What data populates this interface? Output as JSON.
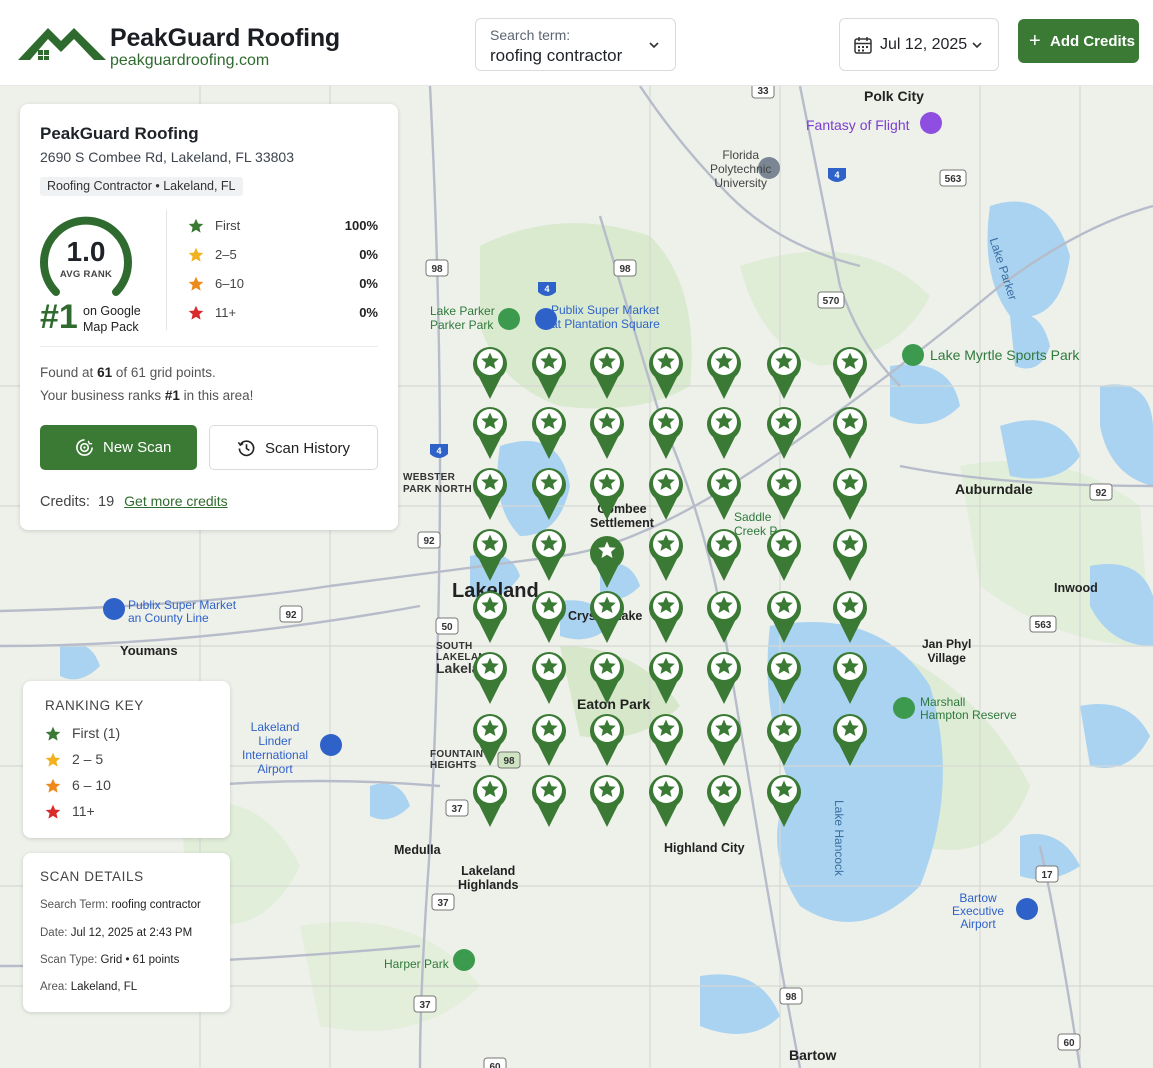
{
  "brand": {
    "name": "PeakGuard Roofing",
    "domain": "peakguardroofing.com"
  },
  "search": {
    "label": "Search term:",
    "value": "roofing contractor"
  },
  "date_picker": {
    "value": "Jul 12, 2025"
  },
  "add_credits": {
    "label": "Add Credits"
  },
  "business": {
    "name": "PeakGuard Roofing",
    "address": "2690 S Combee Rd, Lakeland, FL 33803",
    "category": "Roofing Contractor • Lakeland, FL"
  },
  "summary": {
    "avg_rank": "1.0",
    "avg_rank_caption": "AVG RANK",
    "rank_big": "#1",
    "rank_text_1": "on Google",
    "rank_text_2": "Map Pack",
    "found_prefix": "Found at",
    "found_count": "61",
    "found_of": "of",
    "found_total": "61",
    "found_suffix": "grid points.",
    "ranks_prefix": "Your business ranks",
    "ranks_value": "#1",
    "ranks_suffix": "in this area!"
  },
  "distribution": [
    {
      "label": "First",
      "pct": "100%",
      "color": "#3a7a34"
    },
    {
      "label": "2–5",
      "pct": "0%",
      "color": "#f2b21f"
    },
    {
      "label": "6–10",
      "pct": "0%",
      "color": "#ee8a1a"
    },
    {
      "label": "11+",
      "pct": "0%",
      "color": "#d92b2b"
    }
  ],
  "buttons": {
    "new_scan": "New Scan",
    "scan_history": "Scan History"
  },
  "credits": {
    "label": "Credits:",
    "count": "19",
    "link": "Get more credits"
  },
  "ranking_key": {
    "title": "RANKING KEY",
    "items": [
      {
        "label": "First (1)",
        "color": "#3a7a34"
      },
      {
        "label": "2 – 5",
        "color": "#f2b21f"
      },
      {
        "label": "6 – 10",
        "color": "#ee8a1a"
      },
      {
        "label": "11+",
        "color": "#d92b2b"
      }
    ]
  },
  "scan_details": {
    "title": "SCAN DETAILS",
    "search_term_label": "Search Term:",
    "search_term": "roofing contractor",
    "date_label": "Date:",
    "date": "Jul 12, 2025 at 2:43 PM",
    "scan_type_label": "Scan Type:",
    "scan_type": "Grid • 61 points",
    "area_label": "Area:",
    "area": "Lakeland, FL"
  },
  "map_labels": {
    "polk_city": "Polk City",
    "fantasy": "Fantasy of Flight",
    "florida_poly_1": "Florida",
    "florida_poly_2": "Polytechnic",
    "florida_poly_3": "University",
    "lake_parker_vert": "Lake Parker",
    "lake_parker_park_1": "Lake Parker",
    "lake_parker_park_2": "Parker Park",
    "publix_plantation_1": "Publix Super Market",
    "publix_plantation_2": "at Plantation Square",
    "lake_myrtle": "Lake Myrtle Sports Park",
    "webster_1": "WEBSTER",
    "webster_2": "PARK NORTH",
    "combee_1": "Combee",
    "combee_2": "Settlement",
    "saddle_1": "Saddle",
    "saddle_2": "Creek P",
    "auburndale": "Auburndale",
    "lakeland": "Lakeland",
    "inwood": "Inwood",
    "publix_county_1": "Publix Super Market",
    "publix_county_2": "an County Line",
    "crystal_lake": "Crystal Lake",
    "youmans": "Youmans",
    "south_lakeland_1": "SOUTH",
    "south_lakeland_2": "LAKELAND",
    "south_lakeland_3": "Lakeland",
    "jan_phyl_1": "Jan Phyl",
    "jan_phyl_2": "Village",
    "eaton_park": "Eaton Park",
    "marshall_1": "Marshall",
    "marshall_2": "Hampton Reserve",
    "airport_1": "Lakeland",
    "airport_2": "Linder",
    "airport_3": "International",
    "airport_4": "Airport",
    "fountain_1": "FOUNTAIN",
    "fountain_2": "HEIGHTS",
    "medulla": "Medulla",
    "lakeland_highlands_1": "Lakeland",
    "lakeland_highlands_2": "Highlands",
    "highland_city": "Highland City",
    "lake_hancock_vert": "Lake Hancock",
    "bartow_airport_1": "Bartow",
    "bartow_airport_2": "Executive",
    "bartow_airport_3": "Airport",
    "harper_park": "Harper Park",
    "bartow": "Bartow"
  },
  "grid_pins": {
    "total": 61,
    "rank": 1,
    "color": "#3a7a34",
    "icon": "star-icon"
  }
}
